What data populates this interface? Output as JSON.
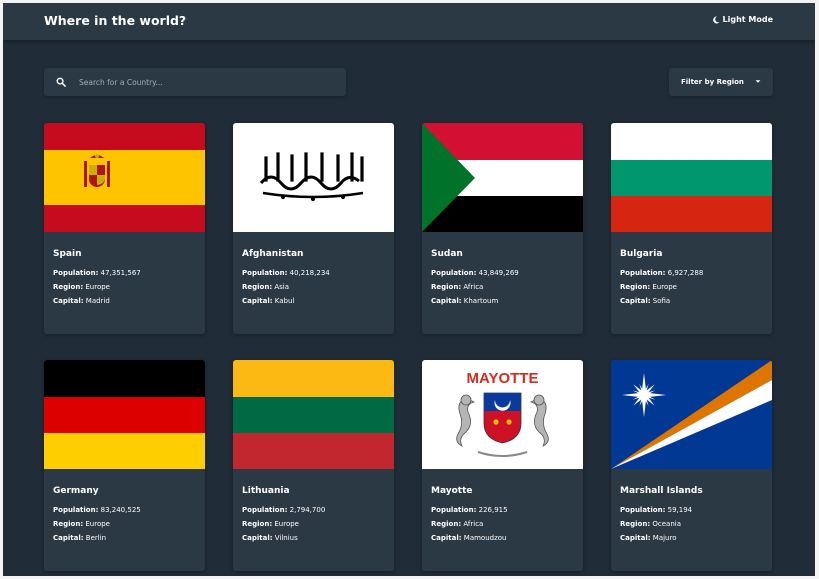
{
  "header": {
    "title": "Where in the world?",
    "theme_toggle_label": "Light Mode",
    "theme_icon": "moon-icon"
  },
  "search": {
    "placeholder": "Search for a Country...",
    "value": "",
    "icon": "search-icon"
  },
  "filter": {
    "label": "Filter by Region",
    "icon": "chevron-down-icon"
  },
  "field_labels": {
    "population": "Population:",
    "region": "Region:",
    "capital": "Capital:"
  },
  "countries": [
    {
      "name": "Spain",
      "population": "47,351,567",
      "region": "Europe",
      "capital": "Madrid",
      "flag": "spain-flag"
    },
    {
      "name": "Afghanistan",
      "population": "40,218,234",
      "region": "Asia",
      "capital": "Kabul",
      "flag": "afghanistan-flag"
    },
    {
      "name": "Sudan",
      "population": "43,849,269",
      "region": "Africa",
      "capital": "Khartoum",
      "flag": "sudan-flag"
    },
    {
      "name": "Bulgaria",
      "population": "6,927,288",
      "region": "Europe",
      "capital": "Sofia",
      "flag": "bulgaria-flag"
    },
    {
      "name": "Germany",
      "population": "83,240,525",
      "region": "Europe",
      "capital": "Berlin",
      "flag": "germany-flag"
    },
    {
      "name": "Lithuania",
      "population": "2,794,700",
      "region": "Europe",
      "capital": "Vilnius",
      "flag": "lithuania-flag"
    },
    {
      "name": "Mayotte",
      "population": "226,915",
      "region": "Africa",
      "capital": "Mamoudzou",
      "flag": "mayotte-flag",
      "flag_text": "MAYOTTE"
    },
    {
      "name": "Marshall Islands",
      "population": "59,194",
      "region": "Oceania",
      "capital": "Majuro",
      "flag": "marshall-islands-flag"
    }
  ],
  "colors": {
    "background": "#202c37",
    "elements": "#2b3945",
    "text": "#ffffff",
    "placeholder": "#a4adb5"
  }
}
